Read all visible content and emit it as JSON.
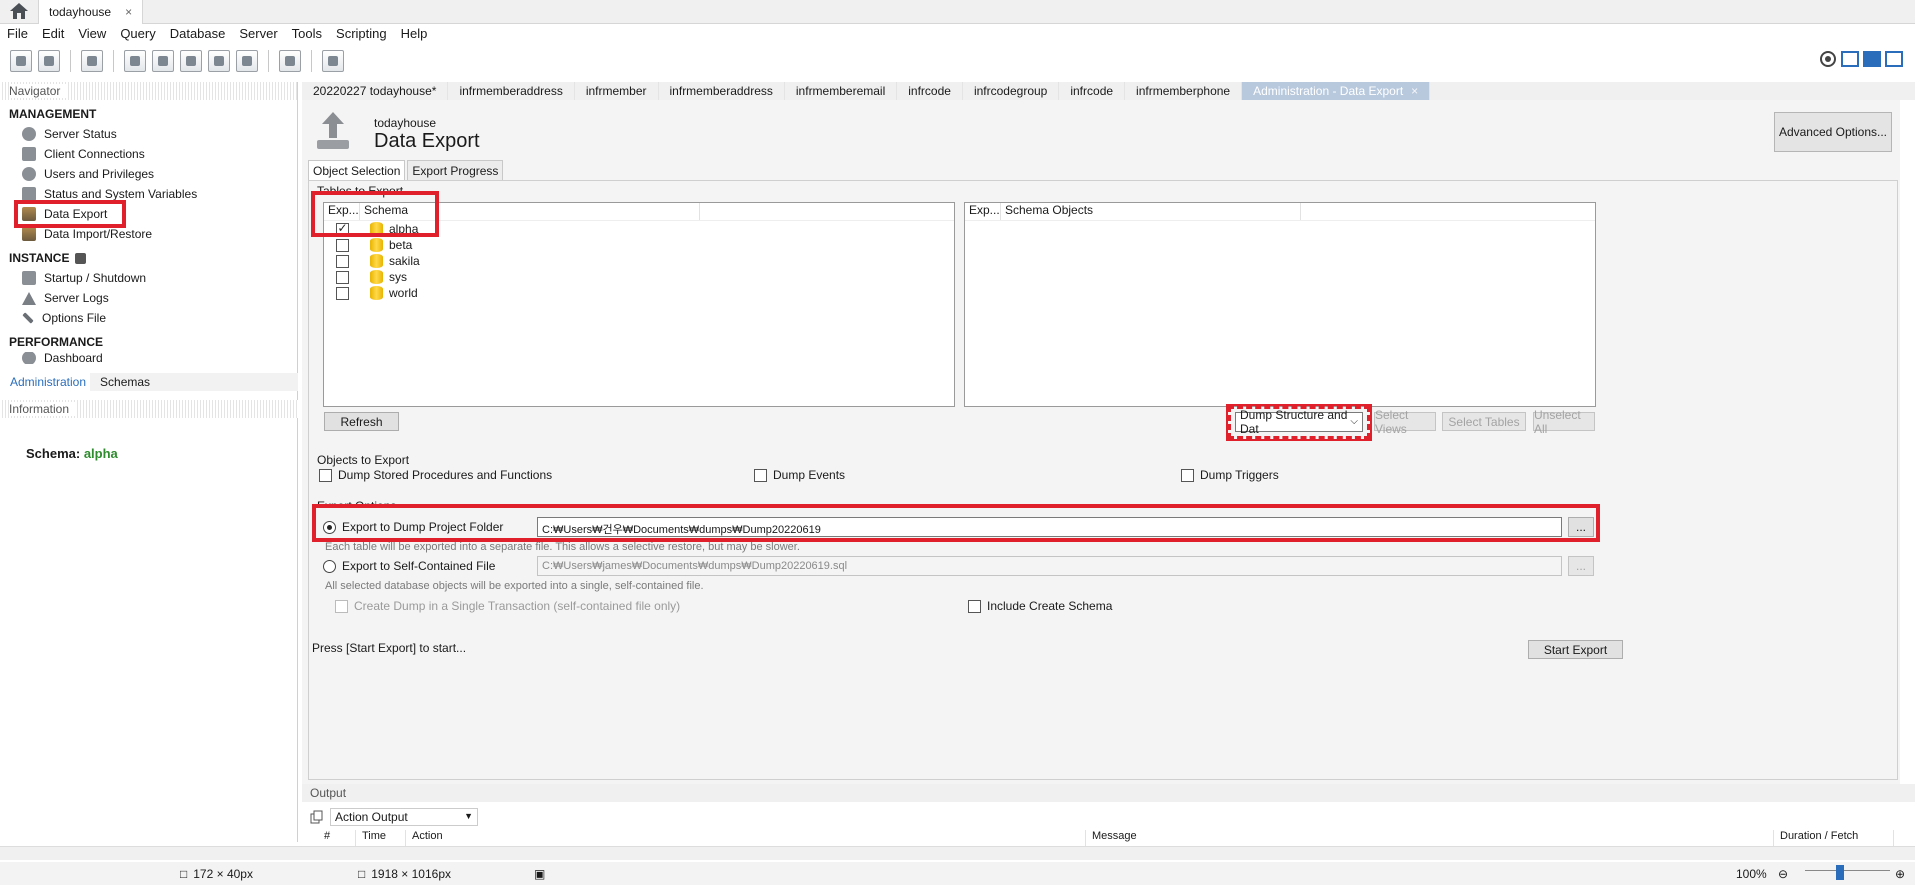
{
  "tabbar": {
    "connection_tab": "todayhouse",
    "close": "×"
  },
  "menu": [
    "File",
    "Edit",
    "View",
    "Query",
    "Database",
    "Server",
    "Tools",
    "Scripting",
    "Help"
  ],
  "navigator": {
    "header": "Navigator",
    "management": {
      "title": "MANAGEMENT",
      "items": [
        "Server Status",
        "Client Connections",
        "Users and Privileges",
        "Status and System Variables",
        "Data Export",
        "Data Import/Restore"
      ]
    },
    "instance": {
      "title": "INSTANCE",
      "items": [
        "Startup / Shutdown",
        "Server Logs",
        "Options File"
      ]
    },
    "performance": {
      "title": "PERFORMANCE",
      "items": [
        "Dashboard"
      ]
    },
    "tabs": [
      "Administration",
      "Schemas"
    ],
    "information_header": "Information",
    "schema_label": "Schema:",
    "schema_value": "alpha"
  },
  "doc_tabs": [
    "20220227 todayhouse*",
    "infrmemberaddress",
    "infrmember",
    "infrmemberaddress",
    "infrmemberemail",
    "infrcode",
    "infrcodegroup",
    "infrcode",
    "infrmemberphone",
    "Administration - Data Export"
  ],
  "page": {
    "subtitle": "todayhouse",
    "title": "Data Export",
    "advanced_button": "Advanced Options...",
    "sub_tabs": [
      "Object Selection",
      "Export Progress"
    ]
  },
  "tables": {
    "group_label": "Tables to Export",
    "left_headers": [
      "Exp...",
      "Schema"
    ],
    "schemas": [
      {
        "name": "alpha",
        "checked": true
      },
      {
        "name": "beta",
        "checked": false
      },
      {
        "name": "sakila",
        "checked": false
      },
      {
        "name": "sys",
        "checked": false
      },
      {
        "name": "world",
        "checked": false
      }
    ],
    "right_headers": [
      "Exp...",
      "Schema Objects"
    ],
    "refresh_button": "Refresh",
    "dump_mode": "Dump Structure and Dat",
    "select_views": "Select Views",
    "select_tables": "Select Tables",
    "unselect_all": "Unselect All"
  },
  "objects": {
    "group_label": "Objects to Export",
    "procedures": "Dump Stored Procedures and Functions",
    "events": "Dump Events",
    "triggers": "Dump Triggers"
  },
  "options": {
    "group_label": "Export Options",
    "dump_folder_label": "Export to Dump Project Folder",
    "dump_folder_path": "C:₩Users₩건우₩Documents₩dumps₩Dump20220619",
    "dump_folder_note": "Each table will be exported into a separate file. This allows a selective restore, but may be slower.",
    "self_contained_label": "Export to Self-Contained File",
    "self_contained_path": "C:₩Users₩james₩Documents₩dumps₩Dump20220619.sql",
    "self_contained_note": "All selected database objects will be exported into a single, self-contained file.",
    "single_transaction": "Create Dump in a Single Transaction (self-contained file only)",
    "include_schema": "Include Create Schema",
    "browse": "..."
  },
  "footer": {
    "press_start": "Press [Start Export] to start...",
    "start_button": "Start Export"
  },
  "output": {
    "header": "Output",
    "select_value": "Action Output",
    "columns": [
      "#",
      "Time",
      "Action",
      "Message",
      "Duration / Fetch"
    ]
  },
  "status": {
    "cursor_size": "172 × 40px",
    "screen_size": "1918 × 1016px",
    "zoom": "100%"
  },
  "colors": {
    "highlight_red": "#e0202a",
    "accent_blue": "#2a6ebb",
    "schema_value_green": "#2e8b2e"
  }
}
